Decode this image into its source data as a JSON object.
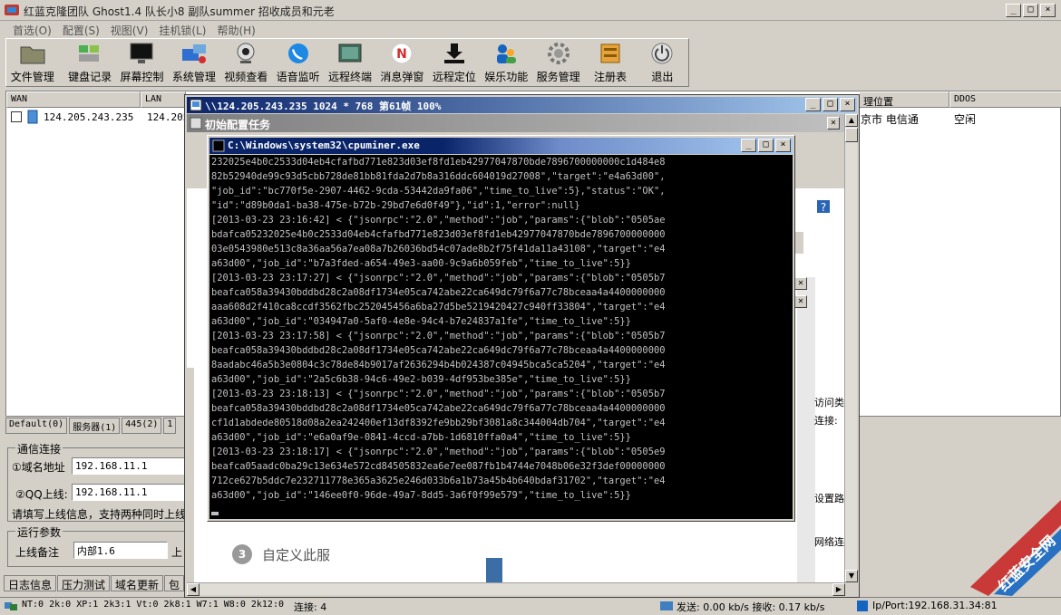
{
  "window": {
    "title": "红蓝克隆团队  Ghost1.4  队长小8  副队summer  招收成员和元老",
    "controls": [
      "_",
      "□",
      "×"
    ]
  },
  "menu": [
    "首选(O)",
    "配置(S)",
    "视图(V)",
    "挂机锁(L)",
    "帮助(H)"
  ],
  "toolbar": [
    {
      "label": "文件管理",
      "icon": "folder-icon"
    },
    {
      "label": "键盘记录",
      "icon": "keyboard-icon"
    },
    {
      "label": "屏幕控制",
      "icon": "monitor-icon"
    },
    {
      "label": "系统管理",
      "icon": "computer-icon"
    },
    {
      "label": "视频查看",
      "icon": "webcam-icon"
    },
    {
      "label": "语音监听",
      "icon": "phone-icon"
    },
    {
      "label": "远程终端",
      "icon": "terminal-icon"
    },
    {
      "label": "消息弹窗",
      "icon": "message-icon"
    },
    {
      "label": "远程定位",
      "icon": "download-icon"
    },
    {
      "label": "娱乐功能",
      "icon": "users-icon"
    },
    {
      "label": "服务管理",
      "icon": "gear-icon"
    },
    {
      "label": "注册表",
      "icon": "registry-icon"
    },
    {
      "label": "退出",
      "icon": "power-icon"
    }
  ],
  "hostlist": {
    "headers": {
      "wan": "WAN",
      "lan": "LAN",
      "location": "理位置",
      "ddos": "DDOS"
    },
    "row": {
      "wan": "124.205.243.235",
      "lan": "124.205",
      "location": "京市 电信通",
      "ddos": "空闲"
    }
  },
  "groups": [
    "Default(0)",
    "服务器(1)",
    "445(2)",
    "1"
  ],
  "connect": {
    "legend": "通信连接",
    "domain_label": "①域名地址",
    "domain_value": "192.168.11.1",
    "qq_label": "②QQ上线:",
    "qq_value": "192.168.11.1",
    "hint": "请填写上线信息，支持两种同时上线"
  },
  "runparams": {
    "legend": "运行参数",
    "remark_label": "上线备注",
    "remark_value": "内部1.6",
    "extra_label": "上"
  },
  "bottom_tabs": [
    "日志信息",
    "压力测试",
    "域名更新",
    "包"
  ],
  "status": {
    "os": "NT:0 2k:0 XP:1 2k3:1 Vt:0 2k8:1 W7:1 W8:0 2k12:0",
    "conn": "连接: 4",
    "speed": "发送: 0.00 kb/s 接收: 0.17 kb/s",
    "ipport": "Ip/Port:192.168.31.34:81"
  },
  "remote": {
    "title": "\\\\124.205.243.235 1024 * 768 第61帧 100%",
    "inner_title": "初始配置任务",
    "step3": "自定义此服",
    "side_texts": [
      "访问类",
      "连接:",
      "设置路",
      "网络连"
    ]
  },
  "cmd": {
    "title": "C:\\Windows\\system32\\cpuminer.exe",
    "lines": [
      "232025e4b0c2533d04eb4cfafbd771e823d03ef8fd1eb42977047870bde7896700000000c1d484e8",
      "82b52940de99c93d5cbb728de81bb81fda2d7b8a316ddc604019d27008\",\"target\":\"e4a63d00\",",
      "\"job_id\":\"bc770f5e-2907-4462-9cda-53442da9fa06\",\"time_to_live\":5},\"status\":\"OK\",",
      "\"id\":\"d89b0da1-ba38-475e-b72b-29bd7e6d0f49\"},\"id\":1,\"error\":null}",
      "[2013-03-23 23:16:42] < {\"jsonrpc\":\"2.0\",\"method\":\"job\",\"params\":{\"blob\":\"0505ae",
      "bdafca05232025e4b0c2533d04eb4cfafbd771e823d03ef8fd1eb42977047870bde7896700000000",
      "03e0543980e513c8a36aa56a7ea08a7b26036bd54c07ade8b2f75f41da11a43108\",\"target\":\"e4",
      "a63d00\",\"job_id\":\"b7a3fded-a654-49e3-aa00-9c9a6b059feb\",\"time_to_live\":5}}",
      "[2013-03-23 23:17:27] < {\"jsonrpc\":\"2.0\",\"method\":\"job\",\"params\":{\"blob\":\"0505b7",
      "beafca058a39430bddbd28c2a08df1734e05ca742abe22ca649dc79f6a77c78bceaa4a4400000000",
      "aaa608d2f410ca8ccdf3562fbc252045456a6ba27d5be5219420427c940ff33804\",\"target\":\"e4",
      "a63d00\",\"job_id\":\"034947a0-5af0-4e8e-94c4-b7e24837a1fe\",\"time_to_live\":5}}",
      "[2013-03-23 23:17:58] < {\"jsonrpc\":\"2.0\",\"method\":\"job\",\"params\":{\"blob\":\"0505b7",
      "beafca058a39430bddbd28c2a08df1734e05ca742abe22ca649dc79f6a77c78bceaa4a4400000000",
      "8aadabc46a5b3e0804c3c78de84b9017af2636294b4b024387c04945bca5ca5204\",\"target\":\"e4",
      "a63d00\",\"job_id\":\"2a5c6b38-94c6-49e2-b039-4df953be385e\",\"time_to_live\":5}}",
      "[2013-03-23 23:18:13] < {\"jsonrpc\":\"2.0\",\"method\":\"job\",\"params\":{\"blob\":\"0505b7",
      "beafca058a39430bddbd28c2a08df1734e05ca742abe22ca649dc79f6a77c78bceaa4a4400000000",
      "cf1d1abdede80518d08a2ea242400ef13df8392fe9bb29bf3081a8c344004db704\",\"target\":\"e4",
      "a63d00\",\"job_id\":\"e6a0af9e-0841-4ccd-a7bb-1d6810ffa0a4\",\"time_to_live\":5}}",
      "[2013-03-23 23:18:17] < {\"jsonrpc\":\"2.0\",\"method\":\"job\",\"params\":{\"blob\":\"0505e9",
      "beafca05aadc0ba29c13e634e572cd84505832ea6e7ee087fb1b4744e7048b06e32f3def00000000",
      "712ce627b5ddc7e232711778e365a3625e246d033b6a1b73a45b4b640bdaf31702\",\"target\":\"e4",
      "a63d00\",\"job_id\":\"146ee0f0-96de-49a7-8dd5-3a6f0f99e579\",\"time_to_live\":5}}"
    ]
  },
  "watermark": "红蓝安全网"
}
